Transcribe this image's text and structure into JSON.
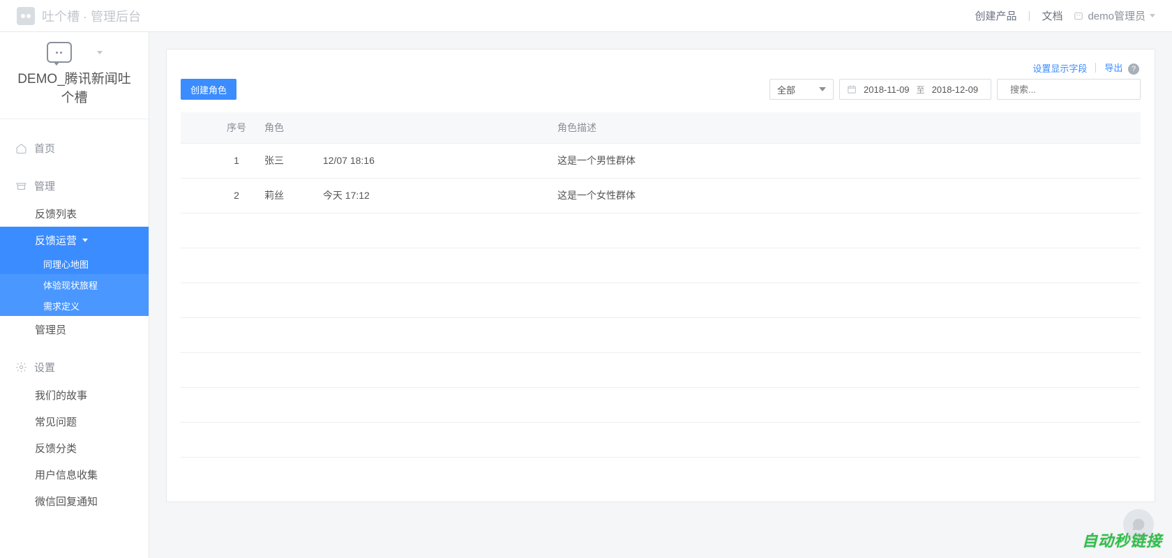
{
  "topbar": {
    "brand": "吐个槽 · 管理后台",
    "create_product": "创建产品",
    "docs": "文档",
    "user_label": "demo管理员"
  },
  "project": {
    "title": "DEMO_腾讯新闻吐个槽"
  },
  "nav": {
    "home": "首页",
    "manage": "管理",
    "feedback_list": "反馈列表",
    "feedback_ops": "反馈运营",
    "sub_empathy": "同理心地图",
    "sub_journey": "体验现状旅程",
    "sub_demand": "需求定义",
    "admins": "管理员",
    "settings": "设置",
    "our_story": "我们的故事",
    "faq": "常见问题",
    "feedback_category": "反馈分类",
    "user_info_collect": "用户信息收集",
    "wechat_reply": "微信回复通知"
  },
  "panel": {
    "fields_link": "设置显示字段",
    "export": "导出",
    "help": "?",
    "create_role": "创建角色",
    "filter_all": "全部",
    "date_from": "2018-11-09",
    "date_to_sep": "至",
    "date_to": "2018-12-09",
    "search_placeholder": "搜索..."
  },
  "table": {
    "columns": {
      "index": "序号",
      "role": "角色",
      "desc": "角色描述"
    },
    "rows": [
      {
        "index": "1",
        "name": "张三",
        "time": "12/07 18:16",
        "desc": "这是一个男性群体"
      },
      {
        "index": "2",
        "name": "莉丝",
        "time": "今天 17:12",
        "desc": "这是一个女性群体"
      }
    ]
  },
  "watermark": "自动秒链接"
}
